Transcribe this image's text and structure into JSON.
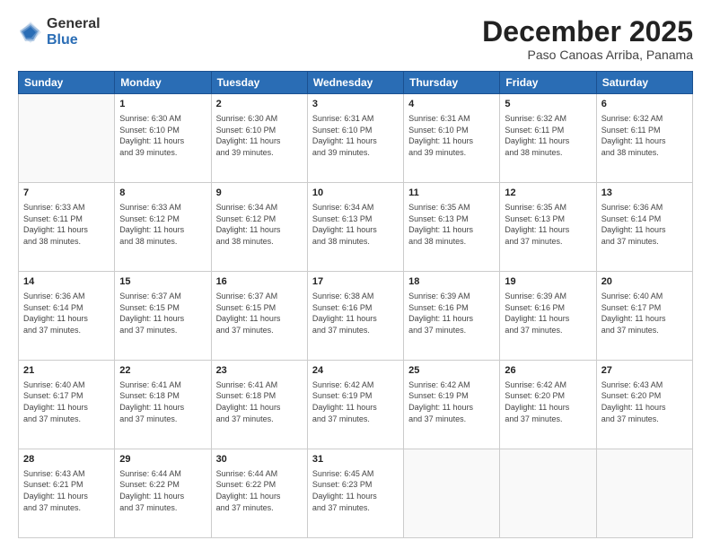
{
  "logo": {
    "general": "General",
    "blue": "Blue"
  },
  "title": "December 2025",
  "subtitle": "Paso Canoas Arriba, Panama",
  "days_header": [
    "Sunday",
    "Monday",
    "Tuesday",
    "Wednesday",
    "Thursday",
    "Friday",
    "Saturday"
  ],
  "weeks": [
    [
      {
        "day": "",
        "info": ""
      },
      {
        "day": "1",
        "info": "Sunrise: 6:30 AM\nSunset: 6:10 PM\nDaylight: 11 hours\nand 39 minutes."
      },
      {
        "day": "2",
        "info": "Sunrise: 6:30 AM\nSunset: 6:10 PM\nDaylight: 11 hours\nand 39 minutes."
      },
      {
        "day": "3",
        "info": "Sunrise: 6:31 AM\nSunset: 6:10 PM\nDaylight: 11 hours\nand 39 minutes."
      },
      {
        "day": "4",
        "info": "Sunrise: 6:31 AM\nSunset: 6:10 PM\nDaylight: 11 hours\nand 39 minutes."
      },
      {
        "day": "5",
        "info": "Sunrise: 6:32 AM\nSunset: 6:11 PM\nDaylight: 11 hours\nand 38 minutes."
      },
      {
        "day": "6",
        "info": "Sunrise: 6:32 AM\nSunset: 6:11 PM\nDaylight: 11 hours\nand 38 minutes."
      }
    ],
    [
      {
        "day": "7",
        "info": "Sunrise: 6:33 AM\nSunset: 6:11 PM\nDaylight: 11 hours\nand 38 minutes."
      },
      {
        "day": "8",
        "info": "Sunrise: 6:33 AM\nSunset: 6:12 PM\nDaylight: 11 hours\nand 38 minutes."
      },
      {
        "day": "9",
        "info": "Sunrise: 6:34 AM\nSunset: 6:12 PM\nDaylight: 11 hours\nand 38 minutes."
      },
      {
        "day": "10",
        "info": "Sunrise: 6:34 AM\nSunset: 6:13 PM\nDaylight: 11 hours\nand 38 minutes."
      },
      {
        "day": "11",
        "info": "Sunrise: 6:35 AM\nSunset: 6:13 PM\nDaylight: 11 hours\nand 38 minutes."
      },
      {
        "day": "12",
        "info": "Sunrise: 6:35 AM\nSunset: 6:13 PM\nDaylight: 11 hours\nand 37 minutes."
      },
      {
        "day": "13",
        "info": "Sunrise: 6:36 AM\nSunset: 6:14 PM\nDaylight: 11 hours\nand 37 minutes."
      }
    ],
    [
      {
        "day": "14",
        "info": "Sunrise: 6:36 AM\nSunset: 6:14 PM\nDaylight: 11 hours\nand 37 minutes."
      },
      {
        "day": "15",
        "info": "Sunrise: 6:37 AM\nSunset: 6:15 PM\nDaylight: 11 hours\nand 37 minutes."
      },
      {
        "day": "16",
        "info": "Sunrise: 6:37 AM\nSunset: 6:15 PM\nDaylight: 11 hours\nand 37 minutes."
      },
      {
        "day": "17",
        "info": "Sunrise: 6:38 AM\nSunset: 6:16 PM\nDaylight: 11 hours\nand 37 minutes."
      },
      {
        "day": "18",
        "info": "Sunrise: 6:39 AM\nSunset: 6:16 PM\nDaylight: 11 hours\nand 37 minutes."
      },
      {
        "day": "19",
        "info": "Sunrise: 6:39 AM\nSunset: 6:16 PM\nDaylight: 11 hours\nand 37 minutes."
      },
      {
        "day": "20",
        "info": "Sunrise: 6:40 AM\nSunset: 6:17 PM\nDaylight: 11 hours\nand 37 minutes."
      }
    ],
    [
      {
        "day": "21",
        "info": "Sunrise: 6:40 AM\nSunset: 6:17 PM\nDaylight: 11 hours\nand 37 minutes."
      },
      {
        "day": "22",
        "info": "Sunrise: 6:41 AM\nSunset: 6:18 PM\nDaylight: 11 hours\nand 37 minutes."
      },
      {
        "day": "23",
        "info": "Sunrise: 6:41 AM\nSunset: 6:18 PM\nDaylight: 11 hours\nand 37 minutes."
      },
      {
        "day": "24",
        "info": "Sunrise: 6:42 AM\nSunset: 6:19 PM\nDaylight: 11 hours\nand 37 minutes."
      },
      {
        "day": "25",
        "info": "Sunrise: 6:42 AM\nSunset: 6:19 PM\nDaylight: 11 hours\nand 37 minutes."
      },
      {
        "day": "26",
        "info": "Sunrise: 6:42 AM\nSunset: 6:20 PM\nDaylight: 11 hours\nand 37 minutes."
      },
      {
        "day": "27",
        "info": "Sunrise: 6:43 AM\nSunset: 6:20 PM\nDaylight: 11 hours\nand 37 minutes."
      }
    ],
    [
      {
        "day": "28",
        "info": "Sunrise: 6:43 AM\nSunset: 6:21 PM\nDaylight: 11 hours\nand 37 minutes."
      },
      {
        "day": "29",
        "info": "Sunrise: 6:44 AM\nSunset: 6:22 PM\nDaylight: 11 hours\nand 37 minutes."
      },
      {
        "day": "30",
        "info": "Sunrise: 6:44 AM\nSunset: 6:22 PM\nDaylight: 11 hours\nand 37 minutes."
      },
      {
        "day": "31",
        "info": "Sunrise: 6:45 AM\nSunset: 6:23 PM\nDaylight: 11 hours\nand 37 minutes."
      },
      {
        "day": "",
        "info": ""
      },
      {
        "day": "",
        "info": ""
      },
      {
        "day": "",
        "info": ""
      }
    ]
  ]
}
